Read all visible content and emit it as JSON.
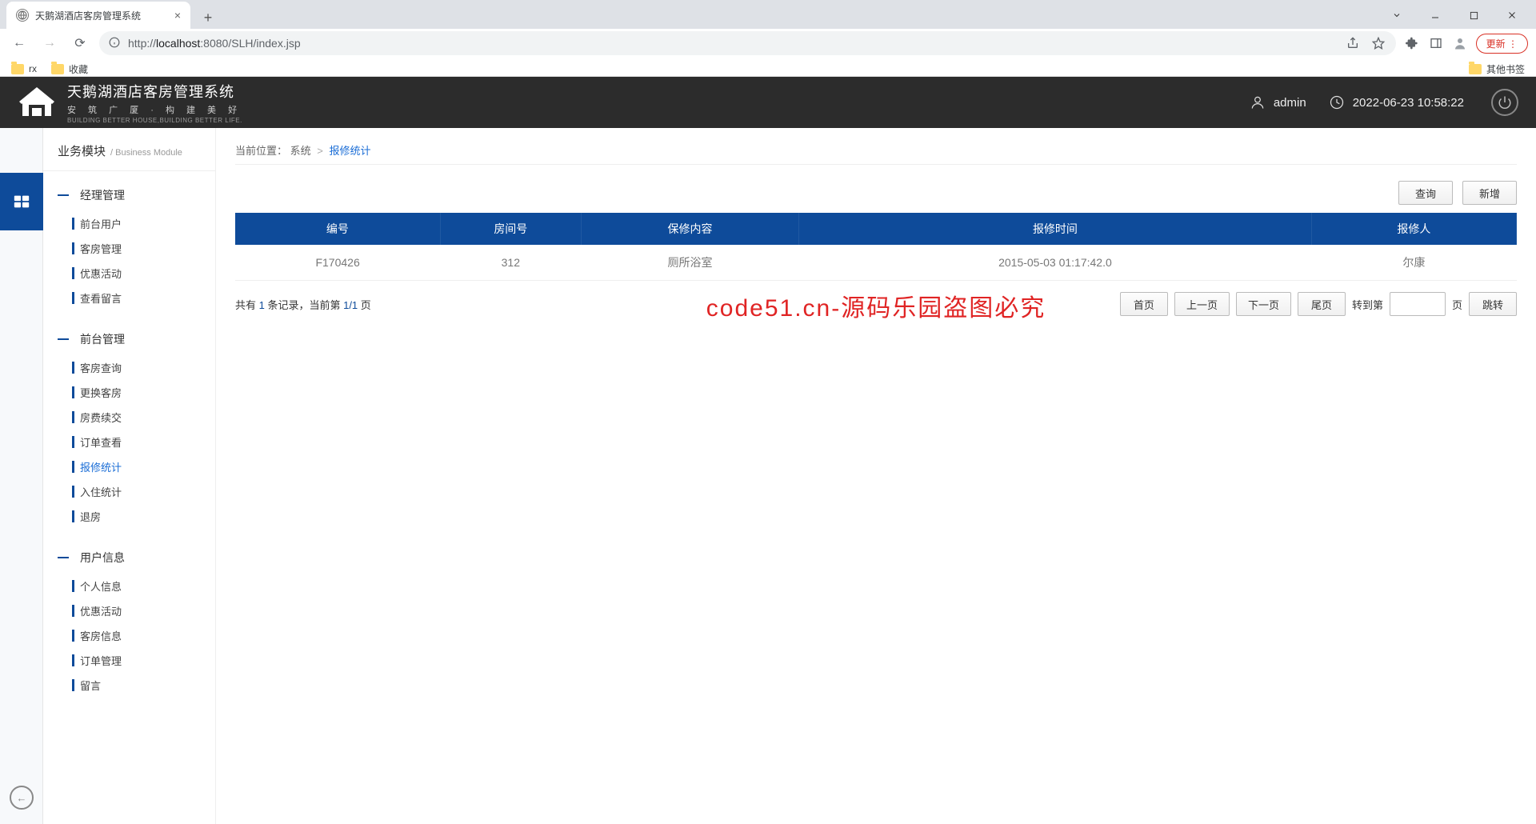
{
  "browser": {
    "tab_title": "天鹅湖酒店客房管理系统",
    "url_display_host": "localhost",
    "url_display_port": ":8080",
    "url_display_path": "/SLH/index.jsp",
    "url_prefix": "http://",
    "update_label": "更新",
    "bookmarks": [
      "rx",
      "收藏"
    ],
    "other_bookmarks": "其他书签"
  },
  "header": {
    "app_title": "天鹅湖酒店客房管理系统",
    "app_sub": "安 筑 广 厦 · 构 建 美 好",
    "app_sub_en": "BUILDING BETTER HOUSE,BUILDING BETTER LIFE.",
    "user": "admin",
    "datetime": "2022-06-23 10:58:22"
  },
  "sidebar": {
    "title_cn": "业务模块",
    "title_sep": "/",
    "title_en": "Business Module",
    "sections": [
      {
        "title": "经理管理",
        "items": [
          "前台用户",
          "客房管理",
          "优惠活动",
          "查看留言"
        ]
      },
      {
        "title": "前台管理",
        "items": [
          "客房查询",
          "更换客房",
          "房费续交",
          "订单查看",
          "报修统计",
          "入住统计",
          "退房"
        ],
        "active_index": 4
      },
      {
        "title": "用户信息",
        "items": [
          "个人信息",
          "优惠活动",
          "客房信息",
          "订单管理",
          "留言"
        ]
      }
    ]
  },
  "breadcrumb": {
    "label": "当前位置：",
    "root": "系统",
    "sep": ">",
    "current": "报修统计"
  },
  "toolbar": {
    "query": "查询",
    "add": "新增"
  },
  "table": {
    "headers": [
      "编号",
      "房间号",
      "保修内容",
      "报修时间",
      "报修人"
    ],
    "rows": [
      {
        "id": "F170426",
        "room": "312",
        "content": "厕所浴室",
        "time": "2015-05-03 01:17:42.0",
        "person": "尔康"
      }
    ]
  },
  "pager": {
    "prefix": "共有 ",
    "total": "1",
    "mid": " 条记录，当前第 ",
    "page": "1/1",
    "suffix": " 页",
    "first": "首页",
    "prev": "上一页",
    "next": "下一页",
    "last": "尾页",
    "jump_label": "转到第",
    "jump_unit": "页",
    "go": "跳转"
  },
  "watermark": "code51.cn-源码乐园盗图必究"
}
